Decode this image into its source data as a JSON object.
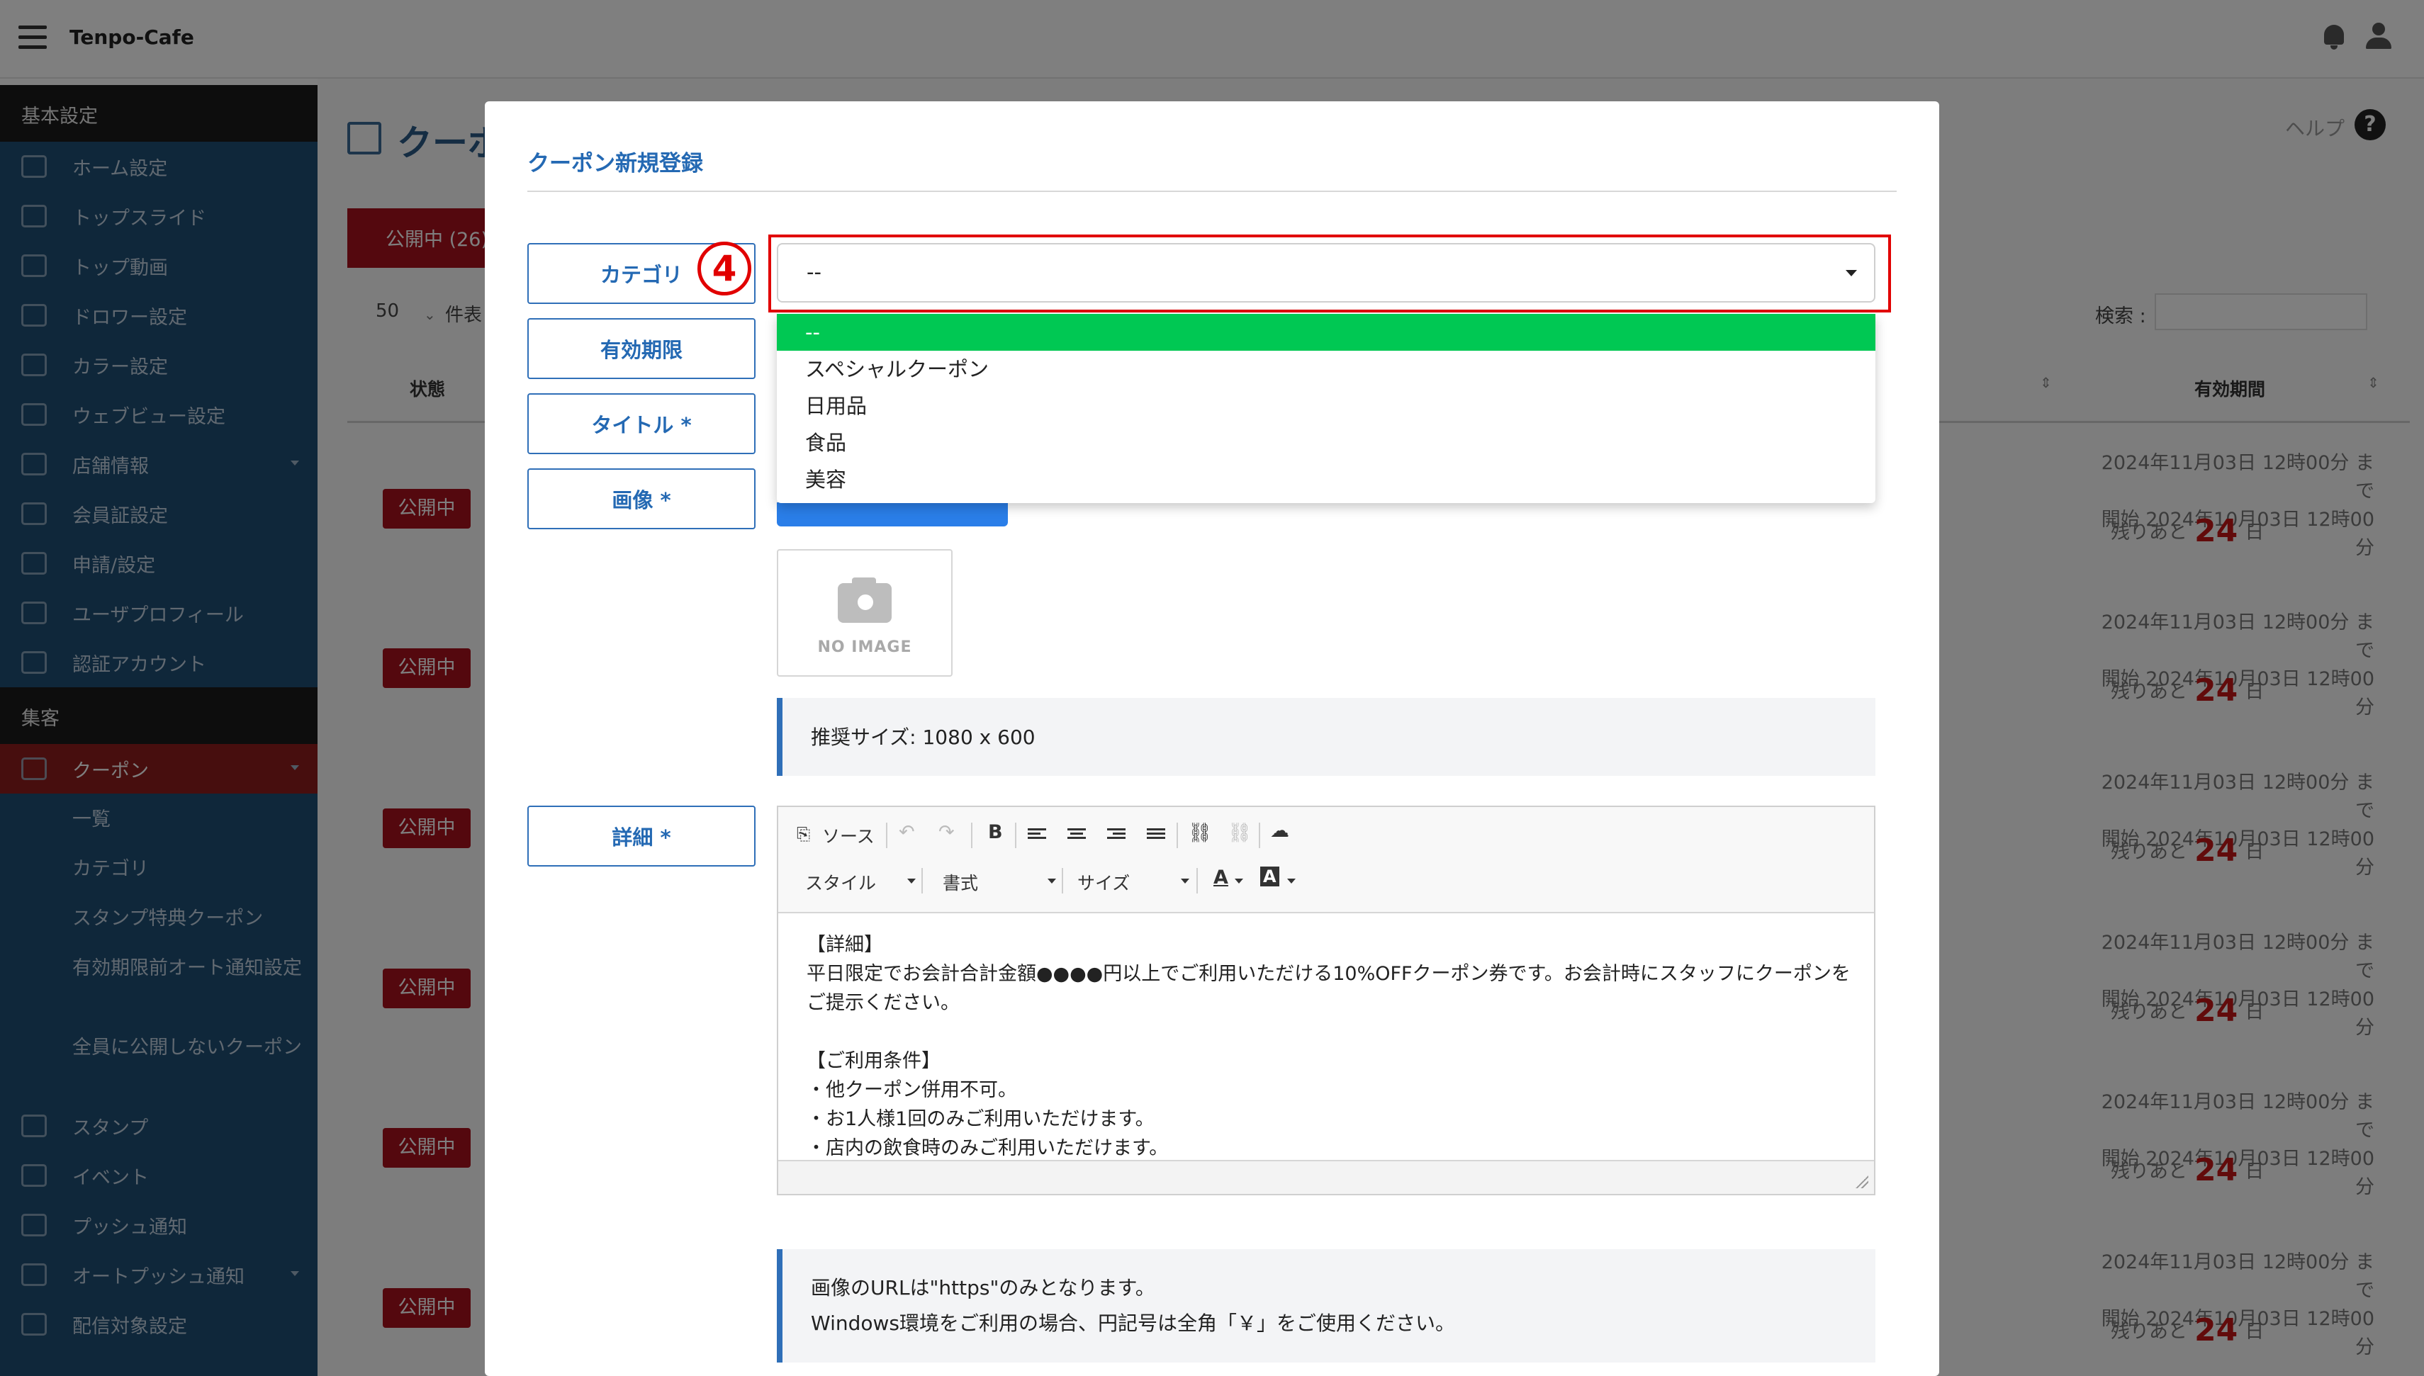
{
  "app": {
    "title": "Tenpo-Cafe"
  },
  "sidebar": {
    "section1": "基本設定",
    "items1": [
      {
        "label": "ホーム設定"
      },
      {
        "label": "トップスライド"
      },
      {
        "label": "トップ動画"
      },
      {
        "label": "ドロワー設定"
      },
      {
        "label": "カラー設定"
      },
      {
        "label": "ウェブビュー設定"
      },
      {
        "label": "店舗情報"
      },
      {
        "label": "会員証設定"
      },
      {
        "label": "申請/設定"
      },
      {
        "label": "ユーザプロフィール"
      },
      {
        "label": "認証アカウント"
      }
    ],
    "section2": "集客",
    "coupon": "クーポン",
    "coupon_sub": [
      "一覧",
      "カテゴリ",
      "スタンプ特典クーポン",
      "有効期限前オート通知設定",
      "全員に公開しないクーポン"
    ],
    "items2": [
      {
        "label": "スタンプ"
      },
      {
        "label": "イベント"
      },
      {
        "label": "プッシュ通知"
      },
      {
        "label": "オートプッシュ通知"
      },
      {
        "label": "配信対象設定"
      }
    ]
  },
  "background": {
    "page_title": "クーポ",
    "help": "ヘルプ",
    "tab_published": "公開中 (26)",
    "per_page": "50",
    "per_page_suffix": "件表",
    "search_label": "検索 :",
    "col_status": "状態",
    "col_valid": "有効期間",
    "row_badge": "公開中",
    "row_end": "2024年11月03日 12時00分 まで",
    "row_start": "開始 2024年10月03日 12時00分",
    "row_remain_prefix": "残りあと",
    "row_remain_days": "24",
    "row_remain_suffix": "日"
  },
  "modal": {
    "title": "クーポン新規登録",
    "labels": {
      "category": "カテゴリ",
      "validity": "有効期限",
      "title": "タイトル *",
      "image": "画像 *",
      "detail": "詳細 *"
    },
    "step_marker": "4",
    "category_select": {
      "value": "--",
      "options": [
        "--",
        "スペシャルクーポン",
        "日用品",
        "食品",
        "美容"
      ]
    },
    "noimage_text": "NO IMAGE",
    "image_hint": "推奨サイズ: 1080 x 600",
    "editor": {
      "source_label": "ソース",
      "style_dd": "スタイル",
      "format_dd": "書式",
      "size_dd": "サイズ",
      "content": "【詳細】\n平日限定でお会計合計金額●●●●円以上でご利用いただける10%OFFクーポン券です。お会計時にスタッフにクーポンをご提示ください。\n\n【ご利用条件】\n・他クーポン併用不可。\n・お1人様1回のみご利用いただけます。\n・店内の飲食時のみご利用いただけます。\n・ご提示いただいたアプリ会員様のみご利用いただけます。"
    },
    "url_note_1": "画像のURLは\"https\"のみとなります。",
    "url_note_2": "Windows環境をご利用の場合、円記号は全角「￥」をご使用ください。"
  },
  "colors": {
    "accent": "#2469b3",
    "highlight": "#e10000",
    "selected_option": "#00c853",
    "sidebar": "#1f4f75",
    "badge": "#a8101c"
  }
}
